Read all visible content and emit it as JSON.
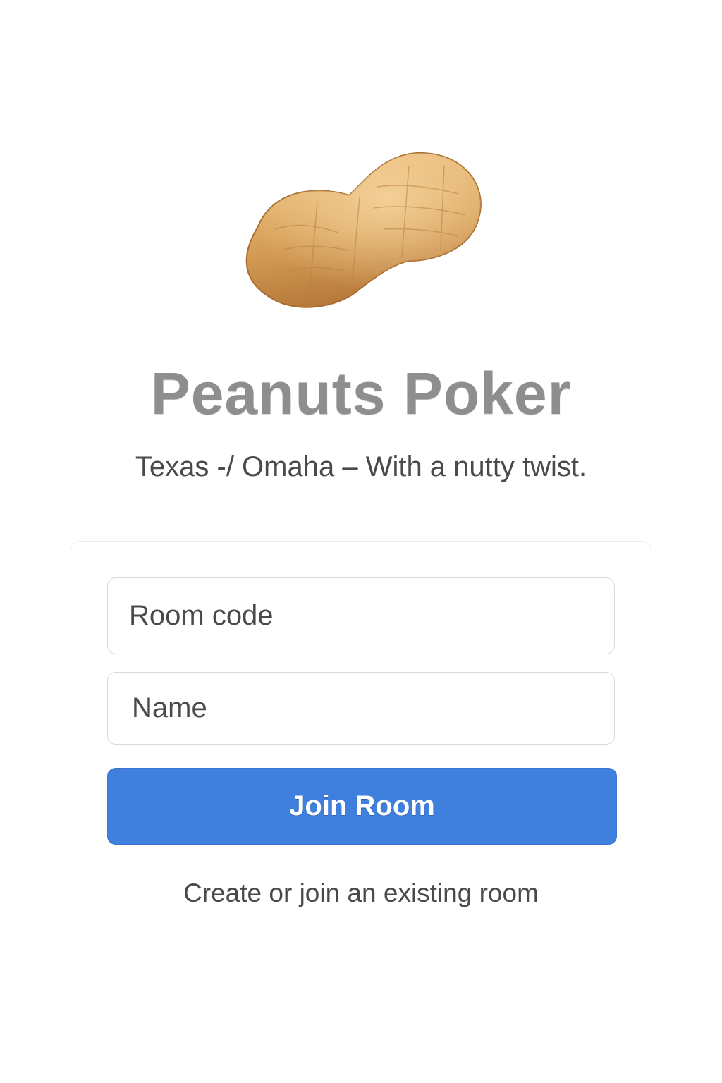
{
  "app": {
    "title": "Peanuts Poker",
    "subtitle": "Texas -/ Omaha  – With a nutty twist.",
    "logo_icon": "peanut-icon"
  },
  "form": {
    "room_code_placeholder": "Room code",
    "name_placeholder": "Name",
    "join_label": "Join Room",
    "footer_text": "Create or join an existing room"
  },
  "colors": {
    "accent": "#3f7fde",
    "title": "#8e8e8e",
    "text": "#4a4a4a",
    "peanut": "#d9a35c"
  }
}
